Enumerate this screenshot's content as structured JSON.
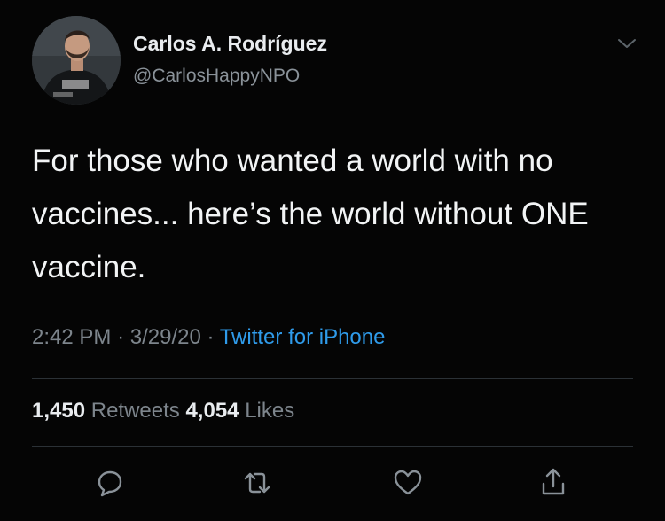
{
  "tweet": {
    "author_name": "Carlos A. Rodríguez",
    "author_handle": "@CarlosHappyNPO",
    "text": "For those who wanted a world with no vaccines... here’s the world without ONE vaccine.",
    "time": "2:42 PM",
    "date": "3/29/20",
    "separator": "·",
    "source": "Twitter for iPhone",
    "retweet_count": "1,450",
    "retweet_label": "Retweets",
    "like_count": "4,054",
    "like_label": "Likes"
  },
  "icons": {
    "menu": "chevron-down-icon",
    "reply": "reply-icon",
    "retweet": "retweet-icon",
    "like": "heart-icon",
    "share": "share-icon"
  },
  "colors": {
    "background": "#050505",
    "link": "#2f9bea",
    "secondary_text": "#7d858c",
    "primary_text": "#f2f4f5"
  }
}
